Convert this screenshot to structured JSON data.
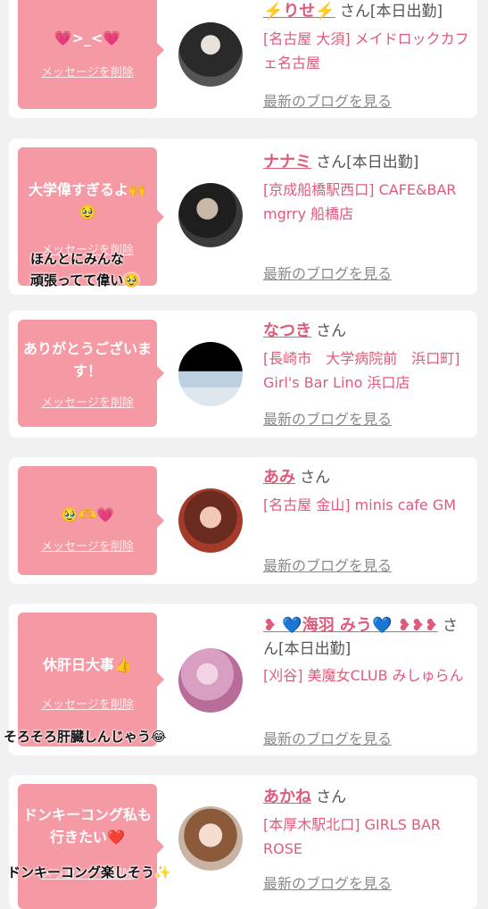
{
  "cards": [
    {
      "message": "💗>_<💗",
      "delete_label": "メッセージを削除",
      "name": "⚡️りせ⚡️",
      "san_suffix": "さん[本日出勤]",
      "shop": "[名古屋 大須] メイドロックカフェ名古屋",
      "blog_label": "最新のブログを見る"
    },
    {
      "message": "大学偉すぎるよ🙌🥹",
      "delete_label": "メッセージを削除",
      "name": "ナナミ",
      "san_suffix": "さん[本日出勤]",
      "shop": "[京成船橋駅西口] CAFE&BAR mgrry 船橋店",
      "blog_label": "最新のブログを見る",
      "overlay": "ほんとにみんな\n頑張ってて偉い🥹"
    },
    {
      "message": "ありがとうございます！",
      "delete_label": "メッセージを削除",
      "name": "なつき",
      "san_suffix": "さん",
      "shop": "[長崎市　大学病院前　浜口町] Girl's Bar Lino 浜口店",
      "blog_label": "最新のブログを見る"
    },
    {
      "message": "🥹🫶💗",
      "delete_label": "メッセージを削除",
      "name": "あみ",
      "san_suffix": "さん",
      "shop": "[名古屋 金山] minis cafe GM",
      "blog_label": "最新のブログを見る"
    },
    {
      "message": "休肝日大事👍",
      "delete_label": "メッセージを削除",
      "name": "❥ 💙海羽 みう💙 ❥❥❥",
      "san_suffix": "さん[本日出勤]",
      "shop": "[刈谷] 美魔女CLUB みしゅらん",
      "blog_label": "最新のブログを見る",
      "overlay": "そろそろ肝臓しんじゃう😂"
    },
    {
      "message": "ドンキーコング私も行きたい❤️",
      "delete_label": "メッセージを削除",
      "name": "あかね",
      "san_suffix": "さん",
      "shop": "[本厚木駅北口] GIRLS BAR ROSE",
      "blog_label": "最新のブログを見る",
      "overlay": "ドンキーコング楽しそう✨"
    }
  ],
  "colors": {
    "bubble": "#f59aa4",
    "accent": "#e05a7a",
    "background": "#f1f1f1"
  }
}
